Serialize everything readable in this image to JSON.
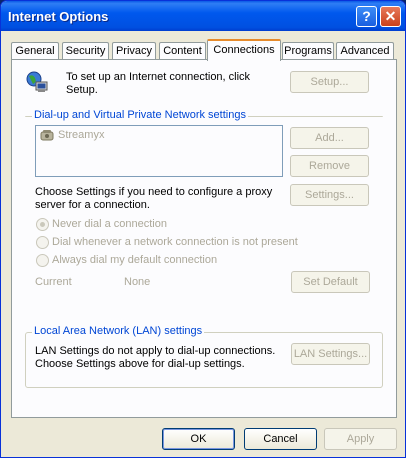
{
  "window": {
    "title": "Internet Options"
  },
  "titlebar_buttons": {
    "help": "?",
    "close": "✕"
  },
  "tabs": [
    {
      "label": "General"
    },
    {
      "label": "Security"
    },
    {
      "label": "Privacy"
    },
    {
      "label": "Content"
    },
    {
      "label": "Connections"
    },
    {
      "label": "Programs"
    },
    {
      "label": "Advanced"
    }
  ],
  "setup_section": {
    "text_line1": "To set up an Internet connection, click",
    "text_line2": "Setup.",
    "setup_button": "Setup..."
  },
  "dialup": {
    "group_label": "Dial-up and Virtual Private Network settings",
    "connections": [
      "Streamyx"
    ],
    "add_button": "Add...",
    "remove_button": "Remove",
    "settings_text_line1": "Choose Settings if you need to configure a proxy",
    "settings_text_line2": "server for a connection.",
    "settings_button": "Settings...",
    "options": [
      {
        "label": "Never dial a connection",
        "selected": true
      },
      {
        "label": "Dial whenever a network connection is not present",
        "selected": false
      },
      {
        "label": "Always dial my default connection",
        "selected": false
      }
    ],
    "current_label": "Current",
    "current_value": "None",
    "set_default_button": "Set Default"
  },
  "lan": {
    "group_label": "Local Area Network (LAN) settings",
    "text_line1": "LAN Settings do not apply to dial-up connections.",
    "text_line2": "Choose Settings above for dial-up settings.",
    "lan_settings_button": "LAN Settings..."
  },
  "footer": {
    "ok_button": "OK",
    "cancel_button": "Cancel",
    "apply_button": "Apply"
  }
}
